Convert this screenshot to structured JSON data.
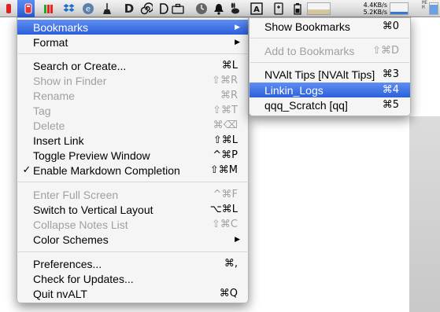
{
  "menubar": {
    "right_icons": [
      "app-red-icon",
      "bars-icon",
      "dropbox-icon",
      "evernote-icon",
      "broom-icon",
      "d-icon",
      "spiral-icon",
      "briefcase-icon",
      "clock-icon",
      "bell-icon",
      "rabbit-icon",
      "keyboard-icon",
      "battery-icon"
    ],
    "net_up": "4.4KB/s",
    "net_down": "5.2KB/s",
    "mem_label": "MEM"
  },
  "main_menu": {
    "items": [
      {
        "label": "Bookmarks",
        "shortcut": "",
        "submenu": true,
        "selected": true,
        "disabled": false
      },
      {
        "label": "Format",
        "shortcut": "",
        "submenu": true,
        "disabled": false
      },
      {
        "label": "Search or Create...",
        "shortcut": "⌘L",
        "disabled": false
      },
      {
        "label": "Show in Finder",
        "shortcut": "⇧⌘R",
        "disabled": true
      },
      {
        "label": "Rename",
        "shortcut": "⌘R",
        "disabled": true
      },
      {
        "label": "Tag",
        "shortcut": "⇧⌘T",
        "disabled": true
      },
      {
        "label": "Delete",
        "shortcut": "⌘⌫",
        "disabled": true
      },
      {
        "label": "Insert Link",
        "shortcut": "⇧⌘L",
        "disabled": false
      },
      {
        "label": "Toggle Preview Window",
        "shortcut": "^⌘P",
        "disabled": false
      },
      {
        "label": "Enable Markdown Completion",
        "shortcut": "⇧⌘M",
        "checked": true,
        "disabled": false
      },
      {
        "label": "Enter Full Screen",
        "shortcut": "^⌘F",
        "disabled": true
      },
      {
        "label": "Switch to Vertical Layout",
        "shortcut": "⌥⌘L",
        "disabled": false
      },
      {
        "label": "Collapse Notes List",
        "shortcut": "⇧⌘C",
        "disabled": true
      },
      {
        "label": "Color Schemes",
        "shortcut": "",
        "submenu": true,
        "disabled": false
      },
      {
        "label": "Preferences...",
        "shortcut": "⌘,",
        "disabled": false
      },
      {
        "label": "Check for Updates...",
        "shortcut": "",
        "disabled": false
      },
      {
        "label": "Quit nvALT",
        "shortcut": "⌘Q",
        "disabled": false
      }
    ],
    "check_mark": "✓",
    "arrow": "▶"
  },
  "sub_menu": {
    "items": [
      {
        "label": "Show Bookmarks",
        "shortcut": "⌘0",
        "disabled": false
      },
      {
        "label": "Add to Bookmarks",
        "shortcut": "⇧⌘D",
        "disabled": true
      },
      {
        "label": "NVAlt Tips [NVAlt Tips]",
        "shortcut": "⌘3",
        "disabled": false
      },
      {
        "label": "Linkin_Logs",
        "shortcut": "⌘4",
        "selected": true,
        "disabled": false
      },
      {
        "label": "qqq_Scratch [qq]",
        "shortcut": "⌘5",
        "disabled": false
      }
    ]
  }
}
